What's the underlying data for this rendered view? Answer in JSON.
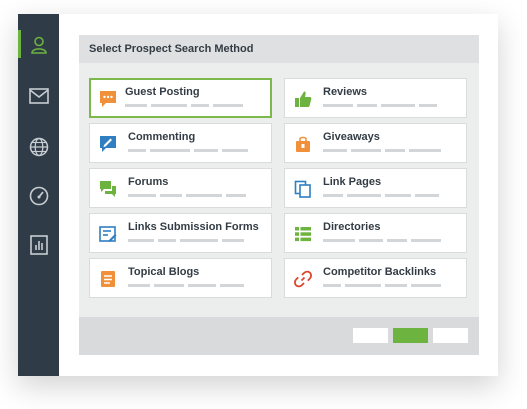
{
  "panel": {
    "title": "Select Prospect Search Method"
  },
  "sidebar": {
    "items": [
      {
        "icon": "user-icon",
        "active": true
      },
      {
        "icon": "mail-icon",
        "active": false
      },
      {
        "icon": "globe-icon",
        "active": false
      },
      {
        "icon": "gauge-icon",
        "active": false
      },
      {
        "icon": "report-icon",
        "active": false
      }
    ]
  },
  "methods": {
    "guest_posting": {
      "label": "Guest Posting",
      "icon": "chat-icon"
    },
    "reviews": {
      "label": "Reviews",
      "icon": "thumbs-up-icon"
    },
    "commenting": {
      "label": "Commenting",
      "icon": "comment-pen-icon"
    },
    "giveaways": {
      "label": "Giveaways",
      "icon": "gift-bag-icon"
    },
    "forums": {
      "label": "Forums",
      "icon": "forum-icon"
    },
    "link_pages": {
      "label": "Link Pages",
      "icon": "copy-pages-icon"
    },
    "links_submission_forms": {
      "label": "Links Submission Forms",
      "icon": "form-edit-icon"
    },
    "directories": {
      "label": "Directories",
      "icon": "list-icon"
    },
    "topical_blogs": {
      "label": "Topical Blogs",
      "icon": "document-icon"
    },
    "competitor_backlinks": {
      "label": "Competitor Backlinks",
      "icon": "link-icon"
    }
  },
  "colors": {
    "sidebar": "#2f3b46",
    "accent_green": "#6db33f",
    "orange": "#f0903a",
    "blue": "#2f7fc1",
    "red": "#d9472b"
  }
}
